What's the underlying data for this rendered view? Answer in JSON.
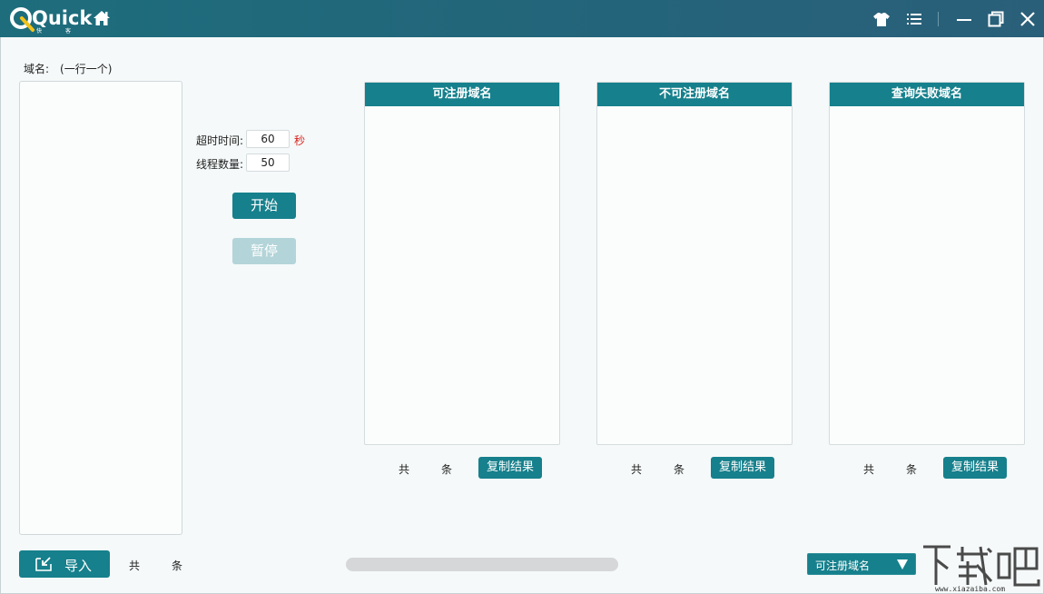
{
  "app": {
    "logo_text": "Quick",
    "logo_sub_left": "快",
    "logo_sub_right": "客"
  },
  "titlebar": {
    "icons": [
      "home-icon",
      "skin-icon",
      "menu-icon",
      "minimize-icon",
      "restore-icon",
      "close-icon"
    ]
  },
  "input_section": {
    "label": "域名:",
    "hint": "(一行一个)",
    "value": ""
  },
  "settings": {
    "timeout_label": "超时时间:",
    "timeout_value": "60",
    "timeout_unit": "秒",
    "threads_label": "线程数量:",
    "threads_value": "50"
  },
  "actions": {
    "start_label": "开始",
    "pause_label": "暂停"
  },
  "panels": [
    {
      "title": "可注册域名",
      "total_prefix": "共",
      "total_suffix": "条",
      "copy_label": "复制结果"
    },
    {
      "title": "不可注册域名",
      "total_prefix": "共",
      "total_suffix": "条",
      "copy_label": "复制结果"
    },
    {
      "title": "查询失败域名",
      "total_prefix": "共",
      "total_suffix": "条",
      "copy_label": "复制结果"
    }
  ],
  "bottom": {
    "import_label": "导入",
    "total_prefix": "共",
    "total_suffix": "条",
    "progress_percent": 0,
    "export_select_value": "可注册域名"
  },
  "watermark": {
    "brand": "下载吧",
    "url": "www.xiazaiba.com"
  },
  "colors": {
    "accent": "#16808c",
    "titlebar": "#1d6d7c",
    "disabled": "#b3d4d8",
    "unit_red": "#d9231d"
  }
}
